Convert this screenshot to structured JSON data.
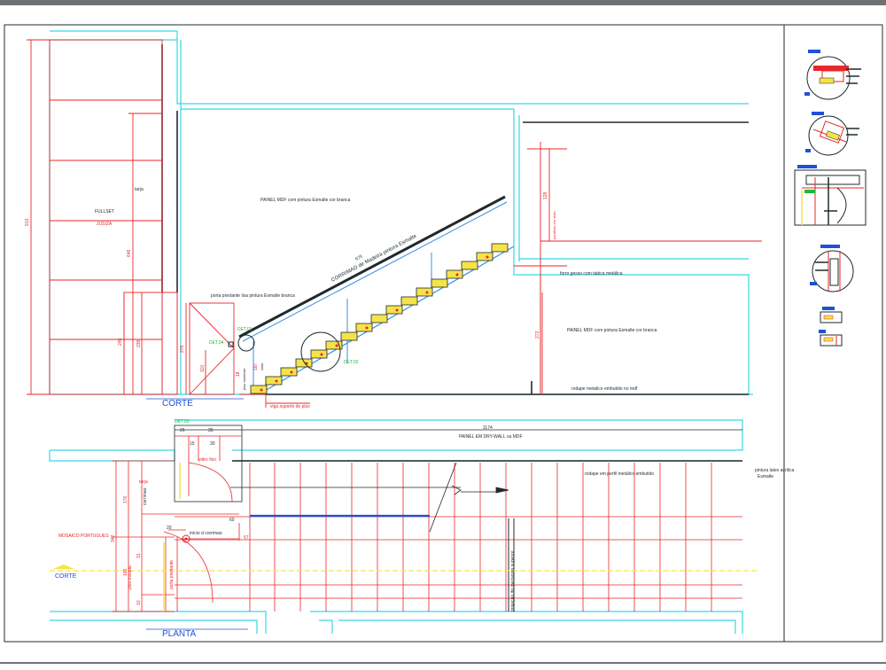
{
  "colors": {
    "cyan": "#39d6e3",
    "red": "#e8262a",
    "dark": "#1f2a2e",
    "blue": "#2050d8",
    "green": "#1fb83a",
    "yellow": "#f5e34a",
    "stair_blue": "#3a8fe0",
    "frame_gray": "#6f7275"
  },
  "titles": {
    "corte": "CORTE",
    "planta": "PLANTA"
  },
  "section_labels": {
    "painel_top": "PAINEL MDF com pintura Esmalte cor branca",
    "painel_right": "PAINEL MDF com pintura Esmalte cor branca",
    "forro_gesso": "forro gesso com tabica metálica",
    "corrimao": "CORRIMAO de Madeira pintura Esmalte",
    "porta_pivotante": "porta pivotante lisa pintura Esmalte branca",
    "rodape_metalico": "rodape metalico embutido no mdf",
    "viga_suporte": "viga suporte de piso",
    "tarja": "tarja",
    "fullset": "FULLSET",
    "jusiza": "JUSIZA",
    "det01": "DET.01",
    "det02": "DET.02",
    "det04": "DET.04",
    "vista": "vista",
    "piso_existente": "piso existente",
    "parafuso_em_vista": "parafuso em vista"
  },
  "section_dims": {
    "d913": "913",
    "d646": "646",
    "d245": "245",
    "d238": "238",
    "d270": "270",
    "d110": "110",
    "d675": "675",
    "d128": "128",
    "d272": "272",
    "d187": "187",
    "d18": "18"
  },
  "plan_labels": {
    "painel_drywall": "PAINEL EM DRY-WALL ou MDF",
    "rodape_perfil": "rodape em perfil metálico embutido",
    "pintura_latex": "pintura latex acrílica",
    "esmalte": "Esmalte",
    "mosaico": "MOSAICO PORTUGUES",
    "corte": "CORTE",
    "det03": "DET.03",
    "inicio_corrimao": "início d corrimao",
    "piso_escada": "piso escada",
    "porta_pivotante": "porta pivotante",
    "corrimao_vertical": "corrimao",
    "vidro_fixo": "vidro fixo",
    "projecao": "projeção do mezanino superior",
    "tarja": "tarja"
  },
  "plan_dims": {
    "d1174": "1174",
    "d26": "26",
    "d35": "35",
    "d15": "15",
    "d30": "30",
    "d342": "342",
    "d176": "176",
    "d160": "160",
    "d10": "10",
    "d20": "20",
    "d60": "60",
    "d57": "57",
    "d31": "31"
  }
}
